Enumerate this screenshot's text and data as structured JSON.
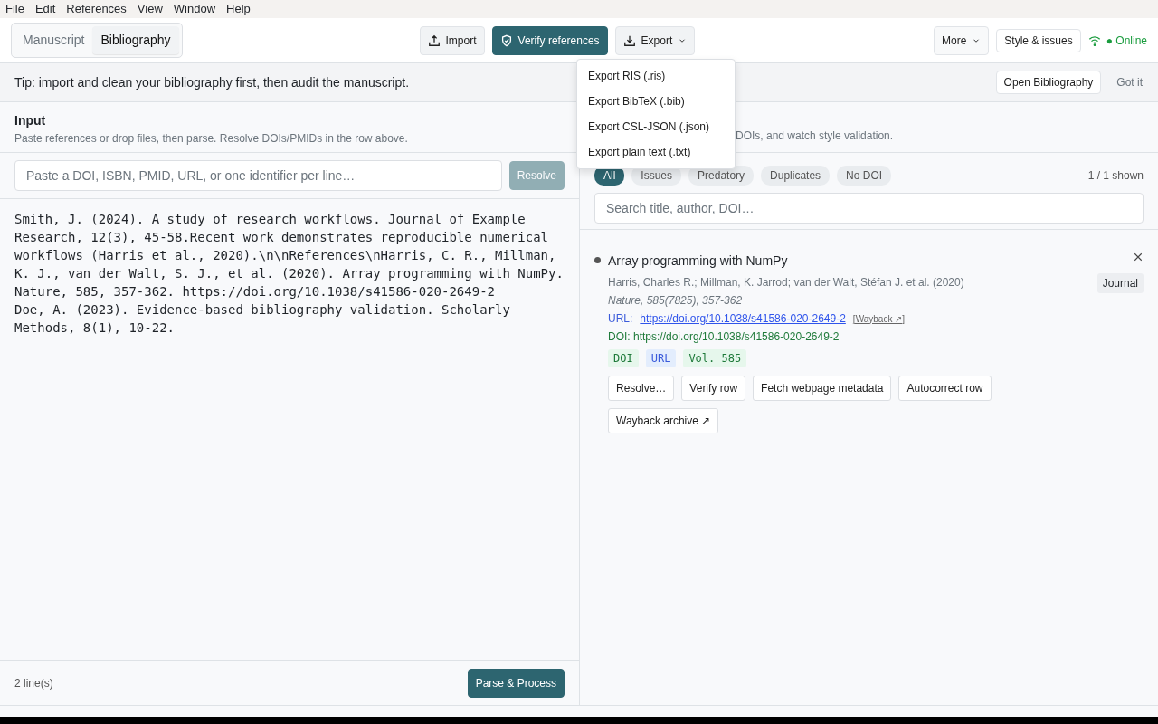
{
  "menu_bar": [
    "File",
    "Edit",
    "References",
    "View",
    "Window",
    "Help"
  ],
  "tabs": [
    {
      "label": "Manuscript",
      "selected": false
    },
    {
      "label": "Bibliography",
      "selected": true
    }
  ],
  "toolbar": {
    "import": "Import",
    "verify": "Verify references",
    "export": "Export",
    "more": "More",
    "style": "Style & issues",
    "status": "● Online",
    "online": true
  },
  "export_menu": {
    "open": true,
    "items": [
      "Export RIS (.ris)",
      "Export BibTeX (.bib)",
      "Export CSL-JSON (.json)",
      "Export plain text (.txt)"
    ]
  },
  "tip": {
    "text": "Tip: import and clean your bibliography first, then audit the manuscript.",
    "open_button": "Open Bibliography",
    "dismiss": "Got it"
  },
  "input_panel": {
    "title": "Input",
    "subtitle": "Paste references or drop files, then parse. Resolve DOIs/PMIDs in the row above.",
    "identifier_placeholder": "Paste a DOI, ISBN, PMID, URL, or one identifier per line…",
    "resolve": "Resolve",
    "resolve_disabled": true,
    "text": "Smith, J. (2024). A study of research workflows. Journal of Example Research, 12(3), 45-58.Recent work demonstrates reproducible numerical workflows (Harris et al., 2020).\\n\\nReferences\\nHarris, C. R., Millman, K. J., van der Walt, S. J., et al. (2020). Array programming with NumPy. Nature, 585, 357-362. https://doi.org/10.1038/s41586-020-2649-2\nDoe, A. (2023). Evidence-based bibliography validation. Scholarly Methods, 8(1), 10-22.",
    "line_count": "2 line(s)",
    "parse": "Parse & Process"
  },
  "library_panel": {
    "subtitle": "DOIs, and watch style validation.",
    "filters": [
      {
        "label": "All",
        "selected": true
      },
      {
        "label": "Issues",
        "selected": false
      },
      {
        "label": "Predatory",
        "selected": false
      },
      {
        "label": "Duplicates",
        "selected": false
      },
      {
        "label": "No DOI",
        "selected": false
      }
    ],
    "shown": "1 / 1 shown",
    "search_placeholder": "Search title, author, DOI…",
    "entries": [
      {
        "title": "Array programming with NumPy",
        "authors": "Harris, Charles R.; Millman, K. Jarrod; van der Walt, Stéfan J. et al. (2020)",
        "source": "Nature, 585(7825), 357-362",
        "url_label": "URL:",
        "url": "https://doi.org/10.1038/s41586-020-2649-2",
        "wayback": "[Wayback ↗]",
        "doi": "DOI: https://doi.org/10.1038/s41586-020-2649-2",
        "type": "Journal",
        "tags": [
          {
            "label": "DOI",
            "color": "#e6f7ec"
          },
          {
            "label": "URL",
            "color": "#e3edfd"
          },
          {
            "label": "Vol. 585",
            "color": "#e6f7ec"
          }
        ],
        "actions": [
          "Resolve…",
          "Verify row",
          "Fetch webpage metadata",
          "Autocorrect row",
          "Wayback archive ↗"
        ]
      }
    ]
  }
}
